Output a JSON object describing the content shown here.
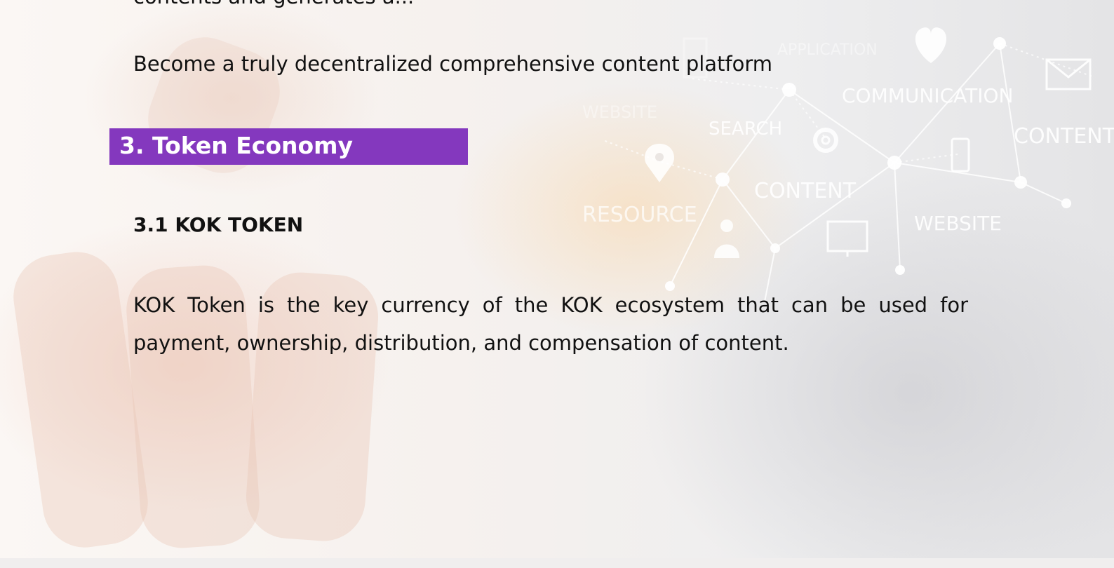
{
  "document": {
    "cut_off_line": "contents and generates a...",
    "intro_line": "Become a truly decentralized comprehensive content platform",
    "section": {
      "number_title": "3. Token Economy",
      "bar_color": "#8438be",
      "text_color": "#ffffff"
    },
    "subsection": {
      "title": "3.1 KOK TOKEN"
    },
    "paragraph": "KOK Token is the key currency of the KOK ecosystem that can be used for payment, ownership, distribution, and compensation of content."
  },
  "background": {
    "network_labels": [
      "APPLICATION",
      "COMMUNICATION",
      "CONTENT",
      "WEBSITE",
      "SEARCH",
      "CONTENT",
      "RESOURCE",
      "WEBSITE"
    ],
    "icons": [
      "heart-icon",
      "envelope-icon",
      "gear-icon",
      "location-pin-icon",
      "smartphone-icon",
      "user-icon",
      "monitor-icon",
      "window-icon"
    ]
  }
}
